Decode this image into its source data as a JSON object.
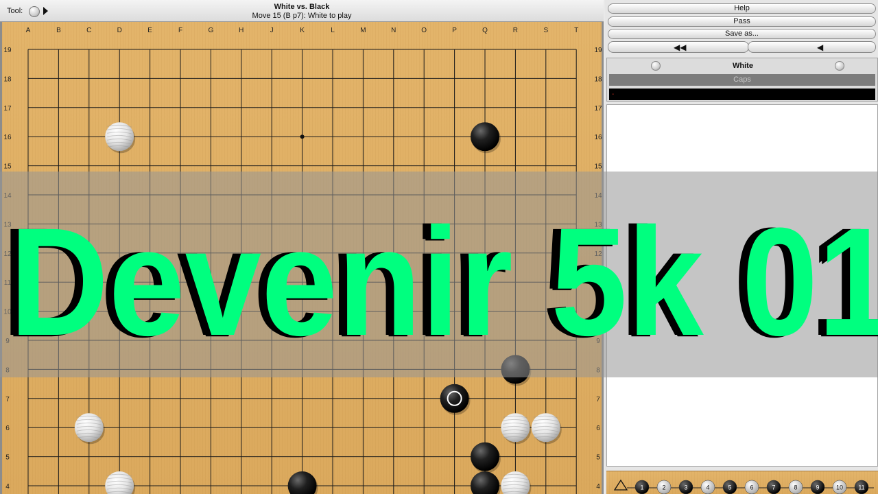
{
  "toolbar": {
    "tool_label": "Tool:"
  },
  "game": {
    "title": "White vs. Black",
    "status": "Move 15 (B p7): White to play"
  },
  "board": {
    "size": 19,
    "columns": [
      "A",
      "B",
      "C",
      "D",
      "E",
      "F",
      "G",
      "H",
      "J",
      "K",
      "L",
      "M",
      "N",
      "O",
      "P",
      "Q",
      "R",
      "S",
      "T"
    ],
    "rows": [
      "19",
      "18",
      "17",
      "16",
      "15",
      "14",
      "13",
      "12",
      "11",
      "10",
      "9",
      "8",
      "7",
      "6",
      "5",
      "4"
    ],
    "hoshi": [
      "K16",
      "Q10"
    ],
    "stones": [
      {
        "color": "white",
        "point": "D16"
      },
      {
        "color": "black",
        "point": "Q16"
      },
      {
        "color": "black",
        "point": "R8"
      },
      {
        "color": "black",
        "point": "P7",
        "last_move": true
      },
      {
        "color": "white",
        "point": "C6"
      },
      {
        "color": "white",
        "point": "R6"
      },
      {
        "color": "white",
        "point": "S6"
      },
      {
        "color": "black",
        "point": "Q5"
      },
      {
        "color": "white",
        "point": "D4"
      },
      {
        "color": "black",
        "point": "K4"
      },
      {
        "color": "black",
        "point": "Q4"
      },
      {
        "color": "white",
        "point": "R4"
      }
    ]
  },
  "side_panel": {
    "buttons": {
      "help": "Help",
      "pass": "Pass",
      "save_as": "Save as..."
    },
    "nav": {
      "rewind_glyph": "◀◀",
      "back_glyph": "◀"
    },
    "player": {
      "name": "White",
      "caps_label": "Caps",
      "message": "-"
    }
  },
  "move_tree": {
    "nodes": [
      {
        "n": "1",
        "color": "black"
      },
      {
        "n": "2",
        "color": "white"
      },
      {
        "n": "3",
        "color": "black"
      },
      {
        "n": "4",
        "color": "white"
      },
      {
        "n": "5",
        "color": "black"
      },
      {
        "n": "6",
        "color": "white"
      },
      {
        "n": "7",
        "color": "black"
      },
      {
        "n": "8",
        "color": "white"
      },
      {
        "n": "9",
        "color": "black"
      },
      {
        "n": "10",
        "color": "white"
      },
      {
        "n": "11",
        "color": "black"
      }
    ]
  },
  "overlay": {
    "title": "Devenir 5k 01"
  },
  "colors": {
    "board": "#dba95d",
    "overlay_text": "#00ff7f",
    "overlay_band": "#969696"
  }
}
